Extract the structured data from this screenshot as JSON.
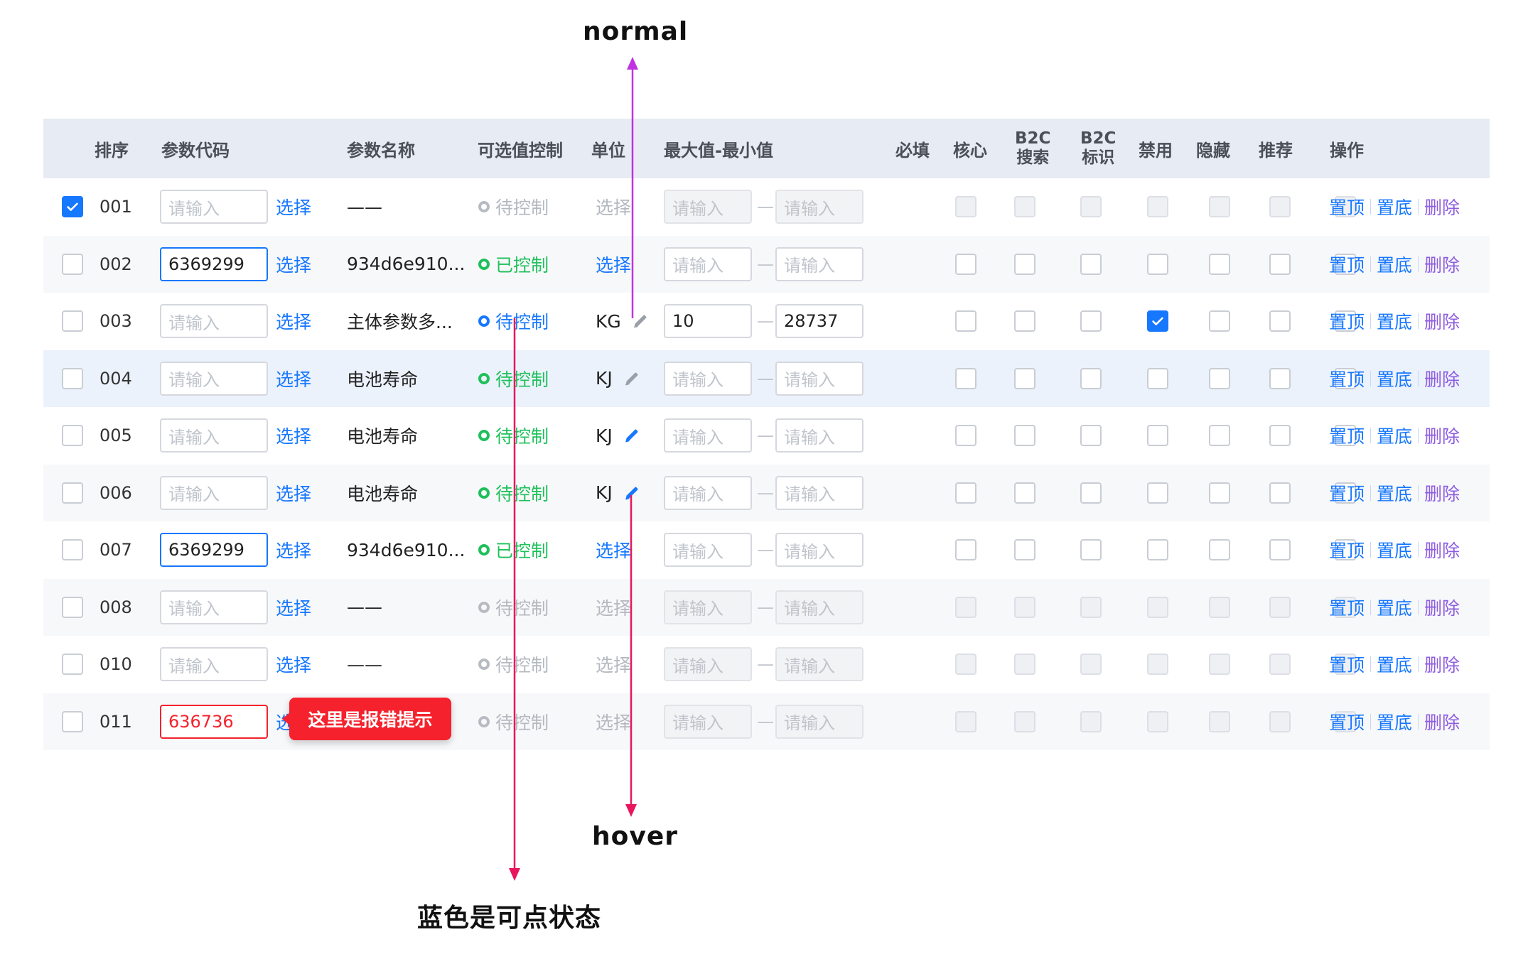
{
  "annotations": {
    "normal": "normal",
    "hover": "hover",
    "clickable": "蓝色是可点状态",
    "error_tip": "这里是报错提示"
  },
  "colors": {
    "accent": "#1677ff",
    "success": "#1ec05a",
    "error": "#f5222d",
    "delete": "#8e5de0",
    "header_bg": "#e7ebf3",
    "arrow_normal": "#c033e0",
    "arrow_hover": "#e8175d"
  },
  "header": {
    "sort": "排序",
    "code": "参数代码",
    "name": "参数名称",
    "control": "可选值控制",
    "unit": "单位",
    "range": "最大值-最小值",
    "required": "必填",
    "core": "核心",
    "b2c_search_1": "B2C",
    "b2c_search_2": "搜索",
    "b2c_mark_1": "B2C",
    "b2c_mark_2": "标识",
    "disabled": "禁用",
    "hidden": "隐藏",
    "recommend": "推荐",
    "actions": "操作"
  },
  "common": {
    "placeholder": "请输入",
    "select": "选择",
    "dash": "—",
    "empty_name": "——",
    "op_top": "置顶",
    "op_bottom": "置底",
    "op_delete": "删除"
  },
  "rows": [
    {
      "seq": "001",
      "checked": true,
      "code": "",
      "code_state": "normal",
      "name": "——",
      "status": "待控制",
      "status_color": "gray",
      "unit": "选择",
      "unit_style": "gray",
      "pen": "none",
      "min": "",
      "max": "",
      "range_disabled": true,
      "flags_disabled": true,
      "b2c_mark": false
    },
    {
      "seq": "002",
      "checked": false,
      "code": "6369299",
      "code_state": "focus",
      "name": "934d6e910...",
      "status": "已控制",
      "status_color": "green",
      "unit": "选择",
      "unit_style": "blue",
      "pen": "none",
      "min": "",
      "max": "",
      "range_disabled": false,
      "flags_disabled": false,
      "b2c_mark": false
    },
    {
      "seq": "003",
      "checked": false,
      "code": "",
      "code_state": "normal",
      "name": "主体参数多...",
      "status": "待控制",
      "status_color": "blue",
      "unit": "KG",
      "unit_style": "text",
      "pen": "gray",
      "min": "10",
      "max": "28737",
      "range_disabled": false,
      "flags_disabled": false,
      "b2c_mark": true
    },
    {
      "seq": "004",
      "checked": false,
      "code": "",
      "code_state": "normal",
      "name": "电池寿命",
      "status": "待控制",
      "status_color": "green",
      "unit": "KJ",
      "unit_style": "text",
      "pen": "gray",
      "min": "",
      "max": "",
      "range_disabled": false,
      "flags_disabled": false,
      "b2c_mark": false
    },
    {
      "seq": "005",
      "checked": false,
      "code": "",
      "code_state": "normal",
      "name": "电池寿命",
      "status": "待控制",
      "status_color": "green",
      "unit": "KJ",
      "unit_style": "text",
      "pen": "blue",
      "min": "",
      "max": "",
      "range_disabled": false,
      "flags_disabled": false,
      "b2c_mark": false
    },
    {
      "seq": "006",
      "checked": false,
      "code": "",
      "code_state": "normal",
      "name": "电池寿命",
      "status": "待控制",
      "status_color": "green",
      "unit": "KJ",
      "unit_style": "text",
      "pen": "blue",
      "min": "",
      "max": "",
      "range_disabled": false,
      "flags_disabled": false,
      "b2c_mark": false
    },
    {
      "seq": "007",
      "checked": false,
      "code": "6369299",
      "code_state": "focus",
      "name": "934d6e910...",
      "status": "已控制",
      "status_color": "green",
      "unit": "选择",
      "unit_style": "blue",
      "pen": "none",
      "min": "",
      "max": "",
      "range_disabled": false,
      "flags_disabled": false,
      "b2c_mark": false
    },
    {
      "seq": "008",
      "checked": false,
      "code": "",
      "code_state": "normal",
      "name": "——",
      "status": "待控制",
      "status_color": "gray",
      "unit": "选择",
      "unit_style": "gray",
      "pen": "none",
      "min": "",
      "max": "",
      "range_disabled": true,
      "flags_disabled": true,
      "b2c_mark": false
    },
    {
      "seq": "010",
      "checked": false,
      "code": "",
      "code_state": "normal",
      "name": "——",
      "status": "待控制",
      "status_color": "gray",
      "unit": "选择",
      "unit_style": "gray",
      "pen": "none",
      "min": "",
      "max": "",
      "range_disabled": true,
      "flags_disabled": true,
      "b2c_mark": false
    },
    {
      "seq": "011",
      "checked": false,
      "code": "636736",
      "code_state": "error",
      "name": "",
      "status": "待控制",
      "status_color": "gray",
      "unit": "选择",
      "unit_style": "gray",
      "pen": "none",
      "min": "",
      "max": "",
      "range_disabled": true,
      "flags_disabled": true,
      "b2c_mark": false
    }
  ]
}
